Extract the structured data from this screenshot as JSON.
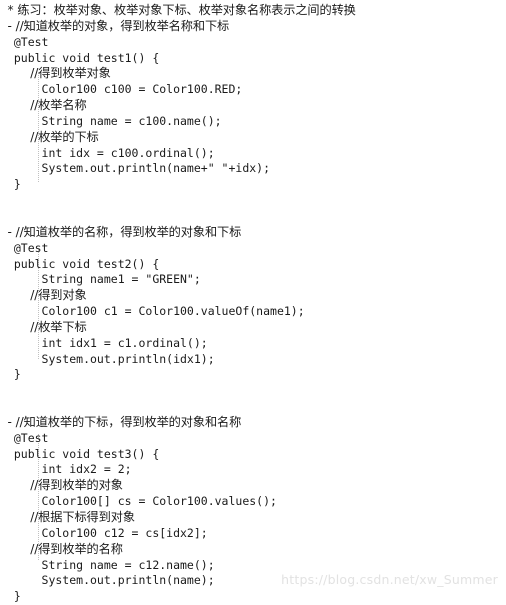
{
  "document": {
    "kind": "code-snippet-image",
    "language": "Java",
    "background_color": "#ffffff",
    "text_color": "#1a1a1a",
    "indent_guide_color": "#c0c0c0"
  },
  "watermark": {
    "text": "https://blog.csdn.net/xw_Summer",
    "color": "#e2e2e2"
  },
  "code": {
    "lines": [
      {
        "id": "l01",
        "text": "  * 练习：枚举对象、枚举对象下标、枚举对象名称表示之间的转换",
        "cjk": true
      },
      {
        "id": "l02",
        "text": "  - //知道枚举的对象，得到枚举名称和下标",
        "cjk": true
      },
      {
        "id": "l03",
        "text": "  @Test",
        "cjk": false
      },
      {
        "id": "l04",
        "text": "  public void test1() {",
        "cjk": false
      },
      {
        "id": "l05",
        "text": "        //得到枚举对象",
        "cjk": true
      },
      {
        "id": "l06",
        "text": "      Color100 c100 = Color100.RED;",
        "cjk": false
      },
      {
        "id": "l07",
        "text": "        //枚举名称",
        "cjk": true
      },
      {
        "id": "l08",
        "text": "      String name = c100.name();",
        "cjk": false
      },
      {
        "id": "l09",
        "text": "        //枚举的下标",
        "cjk": true
      },
      {
        "id": "l10",
        "text": "      int idx = c100.ordinal();",
        "cjk": false
      },
      {
        "id": "l11",
        "text": "      System.out.println(name+\" \"+idx);",
        "cjk": false
      },
      {
        "id": "l12",
        "text": "  }",
        "cjk": false
      },
      {
        "id": "l13",
        "text": "",
        "cjk": false
      },
      {
        "id": "l14",
        "text": "",
        "cjk": false
      },
      {
        "id": "l15",
        "text": "  - //知道枚举的名称，得到枚举的对象和下标",
        "cjk": true
      },
      {
        "id": "l16",
        "text": "  @Test",
        "cjk": false
      },
      {
        "id": "l17",
        "text": "  public void test2() {",
        "cjk": false
      },
      {
        "id": "l18",
        "text": "      String name1 = \"GREEN\";",
        "cjk": false
      },
      {
        "id": "l19",
        "text": "        //得到对象",
        "cjk": true
      },
      {
        "id": "l20",
        "text": "      Color100 c1 = Color100.valueOf(name1);",
        "cjk": false
      },
      {
        "id": "l21",
        "text": "        //枚举下标",
        "cjk": true
      },
      {
        "id": "l22",
        "text": "      int idx1 = c1.ordinal();",
        "cjk": false
      },
      {
        "id": "l23",
        "text": "      System.out.println(idx1);",
        "cjk": false
      },
      {
        "id": "l24",
        "text": "  }",
        "cjk": false
      },
      {
        "id": "l25",
        "text": "",
        "cjk": false
      },
      {
        "id": "l26",
        "text": "",
        "cjk": false
      },
      {
        "id": "l27",
        "text": "  - //知道枚举的下标，得到枚举的对象和名称",
        "cjk": true
      },
      {
        "id": "l28",
        "text": "  @Test",
        "cjk": false
      },
      {
        "id": "l29",
        "text": "  public void test3() {",
        "cjk": false
      },
      {
        "id": "l30",
        "text": "      int idx2 = 2;",
        "cjk": false
      },
      {
        "id": "l31",
        "text": "        //得到枚举的对象",
        "cjk": true
      },
      {
        "id": "l32",
        "text": "      Color100[] cs = Color100.values();",
        "cjk": false
      },
      {
        "id": "l33",
        "text": "        //根据下标得到对象",
        "cjk": true
      },
      {
        "id": "l34",
        "text": "      Color100 c12 = cs[idx2];",
        "cjk": false
      },
      {
        "id": "l35",
        "text": "        //得到枚举的名称",
        "cjk": true
      },
      {
        "id": "l36",
        "text": "      String name = c12.name();",
        "cjk": false
      },
      {
        "id": "l37",
        "text": "      System.out.println(name);",
        "cjk": false
      },
      {
        "id": "l38",
        "text": "  }",
        "cjk": false
      }
    ]
  }
}
